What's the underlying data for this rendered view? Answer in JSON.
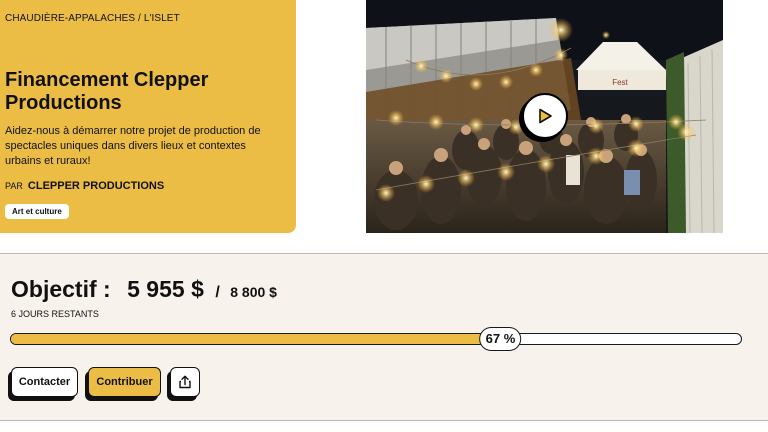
{
  "project": {
    "region": "CHAUDIÈRE-APPALACHES / L'ISLET",
    "title": "Financement Clepper Productions",
    "description": "Aidez-nous à démarrer notre projet de production de spectacles uniques dans divers lieux et contextes urbains et ruraux!",
    "by_label": "PAR",
    "organizer": "CLEPPER PRODUCTIONS",
    "category": "Art et culture"
  },
  "media": {
    "play_icon": "play-icon",
    "tent_sign": "Fest"
  },
  "funding": {
    "goal_label": "Objectif :",
    "raised": "5 955 $",
    "separator": "/",
    "target": "8 800 $",
    "days_left": "6 JOURS RESTANTS",
    "progress_percent": 67,
    "progress_label": "67 %"
  },
  "actions": {
    "contact_label": "Contacter",
    "contribute_label": "Contribuer",
    "share_icon": "share-icon"
  },
  "colors": {
    "accent": "#ecbd45",
    "panel_background": "#f7f3ec",
    "text": "#111111"
  }
}
